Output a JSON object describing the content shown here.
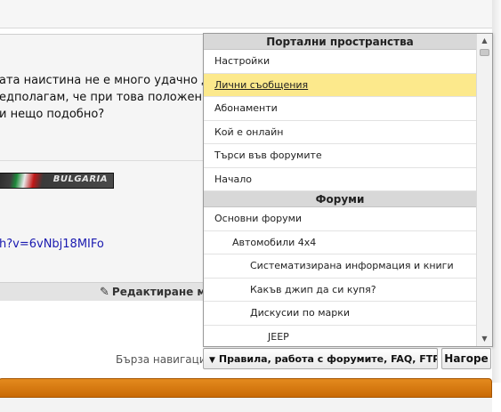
{
  "post": {
    "lines": [
      "ата наистина не е много удачно д",
      "едполагам, че при това положени",
      "и нещо подобно?"
    ],
    "signature_banner": "BULGARIA",
    "link_text": "h?v=6vNbj18MIFo",
    "edit_button": "Редактиране мн"
  },
  "quicknav": {
    "label": "Бърза навигация",
    "selected": "Правила, работа с форумите, FAQ, FTP ...",
    "top_button": "Нагоре"
  },
  "dropdown": {
    "sections": [
      {
        "header": "Портални пространства",
        "items": [
          {
            "label": "Настройки",
            "level": 0,
            "selected": false
          },
          {
            "label": "Лични съобщения",
            "level": 0,
            "selected": true
          },
          {
            "label": "Абонаменти",
            "level": 0,
            "selected": false
          },
          {
            "label": "Кой е онлайн",
            "level": 0,
            "selected": false
          },
          {
            "label": "Търси във форумите",
            "level": 0,
            "selected": false
          },
          {
            "label": "Начало",
            "level": 0,
            "selected": false
          }
        ]
      },
      {
        "header": "Форуми",
        "items": [
          {
            "label": "Основни форуми",
            "level": 0,
            "selected": false
          },
          {
            "label": "Автомобили 4x4",
            "level": 1,
            "selected": false
          },
          {
            "label": "Систематизирана информация и книги",
            "level": 2,
            "selected": false
          },
          {
            "label": "Какъв джип да си купя?",
            "level": 2,
            "selected": false
          },
          {
            "label": "Дискусии по марки",
            "level": 2,
            "selected": false
          },
          {
            "label": "JEEP",
            "level": 3,
            "selected": false
          }
        ]
      }
    ]
  },
  "icons": {
    "edit": "pencil-icon",
    "select_arrow": "triangle-down-icon",
    "scroll_up": "arrow-up-icon",
    "scroll_down": "arrow-down-icon"
  },
  "colors": {
    "selected_item": "#fce98c",
    "orange_bar": "#e48a1e",
    "link": "#1a1ab0"
  }
}
